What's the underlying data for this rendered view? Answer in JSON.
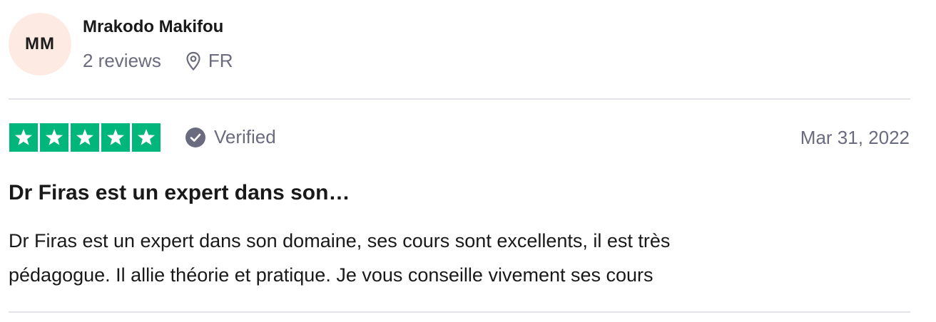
{
  "reviewer": {
    "initials": "MM",
    "name": "Mrakodo Makifou",
    "reviews_count": "2 reviews",
    "country": "FR"
  },
  "review": {
    "rating": 5,
    "rating_max": 5,
    "verified_label": "Verified",
    "date": "Mar 31, 2022",
    "title": "Dr Firas est un expert dans son…",
    "text_line1": "Dr Firas est un expert dans son domaine, ses cours sont excellents, il est très",
    "text_line2": "pédagogue. Il allie théorie et pratique. Je vous conseille vivement ses cours"
  },
  "colors": {
    "star_fill": "#00b67a",
    "avatar_bg": "#fdeae2",
    "muted_text": "#6b6b80"
  },
  "icons": {
    "location": "location-pin-icon",
    "verified": "check-circle-icon",
    "star": "star-icon"
  }
}
